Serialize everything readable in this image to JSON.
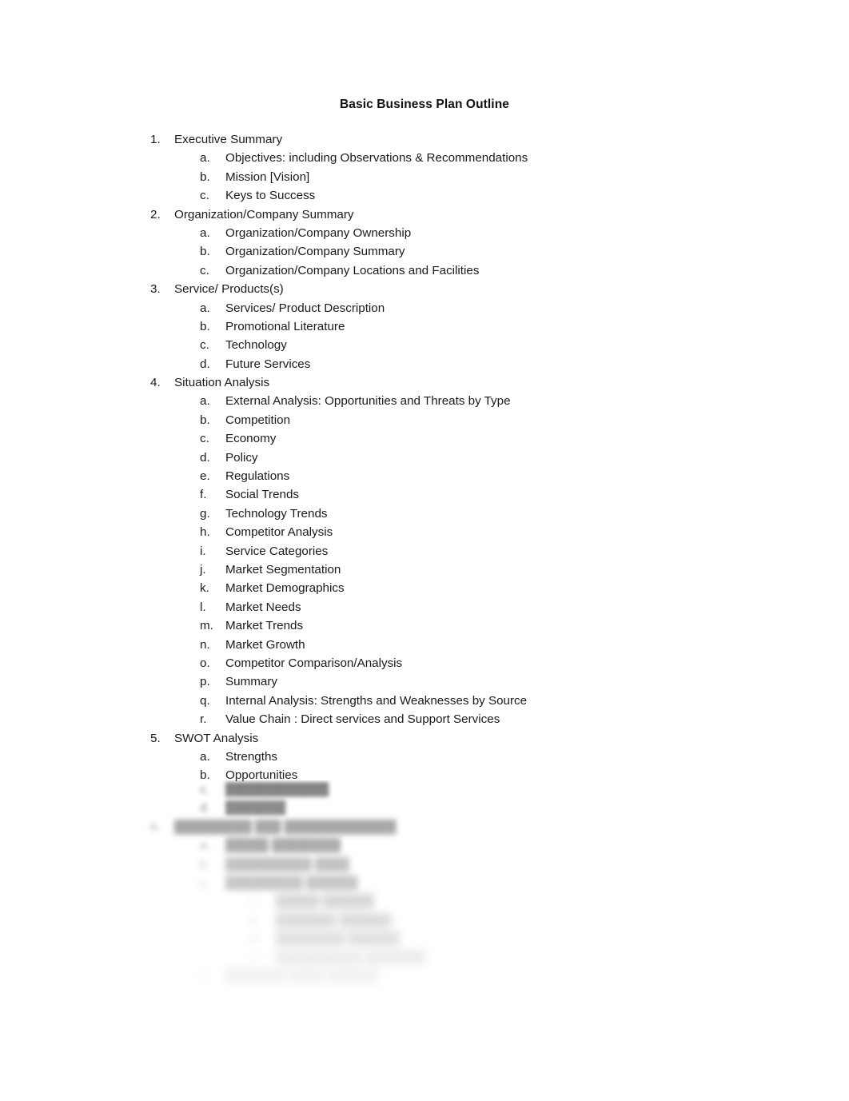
{
  "document": {
    "title": "Basic Business Plan Outline",
    "text_color": "#1a1a1a",
    "background_color": "#ffffff"
  },
  "outline": {
    "visible_items": [
      {
        "level": 1,
        "marker": "1.",
        "label": "Executive Summary"
      },
      {
        "level": 2,
        "marker": "a.",
        "label": "Objectives: including Observations & Recommendations"
      },
      {
        "level": 2,
        "marker": "b.",
        "label": "Mission [Vision]"
      },
      {
        "level": 2,
        "marker": "c.",
        "label": "Keys to Success"
      },
      {
        "level": 1,
        "marker": "2.",
        "label": "Organization/Company Summary"
      },
      {
        "level": 2,
        "marker": "a.",
        "label": "Organization/Company Ownership"
      },
      {
        "level": 2,
        "marker": "b.",
        "label": "Organization/Company Summary"
      },
      {
        "level": 2,
        "marker": "c.",
        "label": "Organization/Company Locations and Facilities"
      },
      {
        "level": 1,
        "marker": "3.",
        "label": "Service/ Products(s)"
      },
      {
        "level": 2,
        "marker": "a.",
        "label": "Services/ Product Description"
      },
      {
        "level": 2,
        "marker": "b.",
        "label": "Promotional Literature"
      },
      {
        "level": 2,
        "marker": "c.",
        "label": "Technology"
      },
      {
        "level": 2,
        "marker": "d.",
        "label": "Future Services"
      },
      {
        "level": 1,
        "marker": "4.",
        "label": "Situation Analysis"
      },
      {
        "level": 2,
        "marker": "a.",
        "label": "External Analysis: Opportunities and Threats by Type"
      },
      {
        "level": 2,
        "marker": "b.",
        "label": "Competition"
      },
      {
        "level": 2,
        "marker": "c.",
        "label": "Economy"
      },
      {
        "level": 2,
        "marker": "d.",
        "label": "Policy"
      },
      {
        "level": 2,
        "marker": "e.",
        "label": "Regulations"
      },
      {
        "level": 2,
        "marker": "f.",
        "label": "Social Trends"
      },
      {
        "level": 2,
        "marker": "g.",
        "label": "Technology Trends"
      },
      {
        "level": 2,
        "marker": "h.",
        "label": "Competitor Analysis"
      },
      {
        "level": 2,
        "marker": "i.",
        "label": "Service Categories"
      },
      {
        "level": 2,
        "marker": "j.",
        "label": "Market Segmentation"
      },
      {
        "level": 2,
        "marker": "k.",
        "label": "Market Demographics"
      },
      {
        "level": 2,
        "marker": "l.",
        "label": "Market Needs"
      },
      {
        "level": 2,
        "marker": "m.",
        "label": "Market Trends"
      },
      {
        "level": 2,
        "marker": "n.",
        "label": "Market Growth"
      },
      {
        "level": 2,
        "marker": "o.",
        "label": "Competitor Comparison/Analysis"
      },
      {
        "level": 2,
        "marker": "p.",
        "label": "Summary"
      },
      {
        "level": 2,
        "marker": "q.",
        "label": "Internal Analysis: Strengths and Weaknesses by Source"
      },
      {
        "level": 2,
        "marker": "r.",
        "label": "Value Chain : Direct services and Support Services"
      },
      {
        "level": 1,
        "marker": "5.",
        "label": "SWOT Analysis"
      },
      {
        "level": 2,
        "marker": "a.",
        "label": "Strengths"
      },
      {
        "level": 2,
        "marker": "b.",
        "label": "Opportunities"
      }
    ],
    "obscured_items": [
      {
        "level": 2,
        "marker": "c.",
        "label": "████████████"
      },
      {
        "level": 2,
        "marker": "d.",
        "label": "███████"
      },
      {
        "level": 1,
        "marker": "6.",
        "label": "█████████ ███ █████████████"
      },
      {
        "level": 2,
        "marker": "a.",
        "label": "█████ ████████"
      },
      {
        "level": 2,
        "marker": "b.",
        "label": "██████████ ████"
      },
      {
        "level": 2,
        "marker": "c.",
        "label": "█████████ ██████"
      },
      {
        "level": 3,
        "marker": "i.",
        "label": "█████ ██████"
      },
      {
        "level": 3,
        "marker": "ii.",
        "label": "███████ ██████"
      },
      {
        "level": 3,
        "marker": "iii.",
        "label": "████████ ██████"
      },
      {
        "level": 3,
        "marker": "iv.",
        "label": "██████████ ███████"
      },
      {
        "level": 2,
        "marker": "d.",
        "label": "███████ ████ ██████"
      }
    ]
  }
}
